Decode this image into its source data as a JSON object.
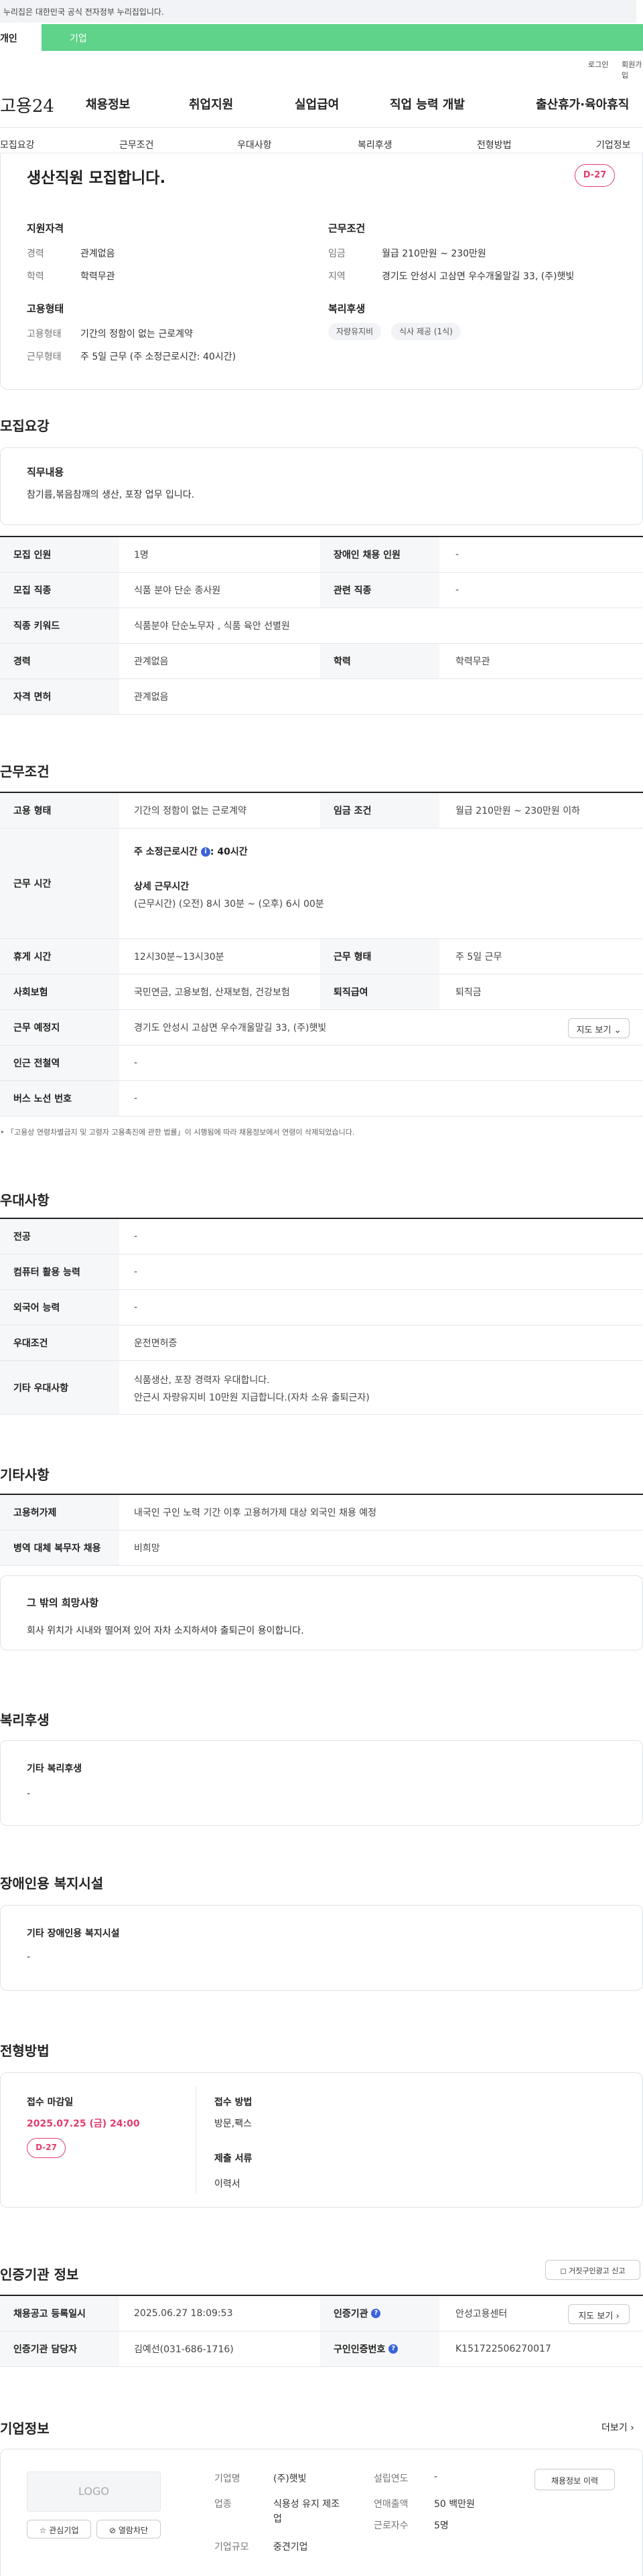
{
  "gov_banner": "이 누리집은 대한민국 공식 전자정부 누리집입니다.",
  "top_tabs": {
    "personal": "개인",
    "corporate": "기업"
  },
  "util": {
    "login": "로그인",
    "join": "회원가입"
  },
  "logo": "고용24",
  "gnb": [
    "채용정보",
    "취업지원",
    "실업급여",
    "직업 능력 개발",
    "출산휴가·육아휴직"
  ],
  "subnav": [
    "모집요강",
    "근무조건",
    "우대사항",
    "복리후생",
    "전형방법",
    "기업정보"
  ],
  "hero": {
    "title": "생산직원 모집합니다.",
    "dday": "D-27",
    "qual_title": "지원자격",
    "qual": [
      {
        "k": "경력",
        "v": "관계없음"
      },
      {
        "k": "학력",
        "v": "학력무관"
      }
    ],
    "cond_title": "근무조건",
    "cond": [
      {
        "k": "임금",
        "v": "월급 210만원 ~ 230만원"
      },
      {
        "k": "지역",
        "v": "경기도 안성시 고삼면 우수개울말길 33, (주)햇빛"
      }
    ],
    "emp_title": "고용형태",
    "emp": [
      {
        "k": "고용형태",
        "v": "기간의 정함이 없는 근로계약"
      },
      {
        "k": "근무형태",
        "v": "주 5일 근무 (주 소정근로시간: 40시간)"
      }
    ],
    "welfare_title": "복리후생",
    "welfare_chips": [
      "자량유지비",
      "식사 제공 (1식)"
    ]
  },
  "recruit": {
    "title": "모집요강",
    "duty_title": "직무내용",
    "duty_text": "참기름,볶음참깨의 생산, 포장 업무 입니다.",
    "rows": [
      {
        "k1": "모집 인원",
        "v1": "1명",
        "k2": "장애인 채용 인원",
        "v2": "-"
      },
      {
        "k1": "모집 직종",
        "v1": "식품 분야 단순 종사원",
        "k2": "관련 직종",
        "v2": "-"
      },
      {
        "k1": "직종 키워드",
        "v1": "식품분야 단순노무자 , 식품 육안 선별원"
      },
      {
        "k1": "경력",
        "v1": "관계없음",
        "k2": "학력",
        "v2": "학력무관"
      },
      {
        "k1": "자격 면허",
        "v1": "관계없음"
      }
    ]
  },
  "work": {
    "title": "근무조건",
    "type_k": "고용 형태",
    "type_v": "기간의 정함이 없는 근로계약",
    "wage_k": "임금 조건",
    "wage_v": "월급 210만원 ~ 230만원 이하",
    "hours_k": "근무 시간",
    "hours_main": "주 소정근로시간",
    "hours_main_v": ": 40시간",
    "hours_detail_title": "상세 근무시간",
    "hours_detail": "(근무시간) (오전) 8시 30분 ~ (오후) 6시 00분",
    "break_k": "휴게 시간",
    "break_v": "12시30분~13시30분",
    "form_k": "근무 형태",
    "form_v": "주 5일 근무",
    "ins_k": "사회보험",
    "ins_v": "국민연금, 고용보험, 산재보험, 건강보험",
    "ret_k": "퇴직급여",
    "ret_v": "퇴직금",
    "place_k": "근무 예정지",
    "place_v": "경기도 안성시 고삼면 우수개울말길 33, (주)햇빛",
    "map_btn": "지도 보기",
    "subway_k": "인근 전철역",
    "subway_v": "-",
    "bus_k": "버스 노선 번호",
    "bus_v": "-",
    "note": "「고용상 연령차별금지 및 고령자 고용촉진에 관한 법률」이 시행됨에 따라 채용정보에서 연령이 삭제되었습니다."
  },
  "pref": {
    "title": "우대사항",
    "rows": [
      {
        "k": "전공",
        "v": "-"
      },
      {
        "k": "컴퓨터 활용 능력",
        "v": "-"
      },
      {
        "k": "외국어 능력",
        "v": "-"
      },
      {
        "k": "우대조건",
        "v": "운전면허증"
      },
      {
        "k": "기타 우대사항",
        "v": "식품생산, 포장  경력자 우대합니다.",
        "v2": "안근시 자량유지비 10만원 지급합니다.(자차 소유 출퇴근자)"
      }
    ]
  },
  "etc": {
    "title": "기타사항",
    "rows": [
      {
        "k": "고용허가제",
        "v": "내국인 구인 노력 기간 이후 고용허가제 대상 외국인 채용 예정"
      },
      {
        "k": "병역 대체 복무자 채용",
        "v": "비희망"
      }
    ],
    "wish_title": "그 밖의 희망사항",
    "wish_text": "회사 위치가 시내와 떨어져 있어 자차 소지하셔야 출퇴근이 용이합니다."
  },
  "welfare": {
    "title": "복리후생",
    "box_title": "기타 복리후생",
    "box_v": "-"
  },
  "disab": {
    "title": "장애인용 복지시설",
    "box_title": "기타 장애인용 복지시설",
    "box_v": "-"
  },
  "screen": {
    "title": "전형방법",
    "deadline_k": "접수 마감일",
    "deadline_v": "2025.07.25 (금) 24:00",
    "dday": "D-27",
    "method_k": "접수 방법",
    "method_v": "방문,팩스",
    "docs_k": "제출 서류",
    "docs_v": "이력서"
  },
  "agency": {
    "title": "인증기관 정보",
    "report_btn": "거짓구인광고 신고",
    "reg_k": "채용공고 등록일시",
    "reg_v": "2025.06.27 18:09:53",
    "org_k": "인증기관",
    "org_v": "안성고용센터",
    "map_btn": "지도 보기",
    "mgr_k": "인증기관 담당자",
    "mgr_v": "김예선(031-686-1716)",
    "no_k": "구인인증번호",
    "no_v": "K151722506270017"
  },
  "company": {
    "title": "기업정보",
    "more": "더보기",
    "logo": "LOGO",
    "fav_btn": "관심기업",
    "block_btn": "열람차단",
    "name_k": "기업명",
    "name_v": "(주)햇빛",
    "ind_k": "업종",
    "ind_v": "식용성 유지 제조업",
    "size_k": "기업규모",
    "size_v": "중견기업",
    "est_k": "설립연도",
    "est_v": "-",
    "sales_k": "연매출액",
    "sales_v": "50 백만원",
    "emp_k": "근로자수",
    "emp_v": "5명",
    "job_btn": "채용정보 이력"
  }
}
